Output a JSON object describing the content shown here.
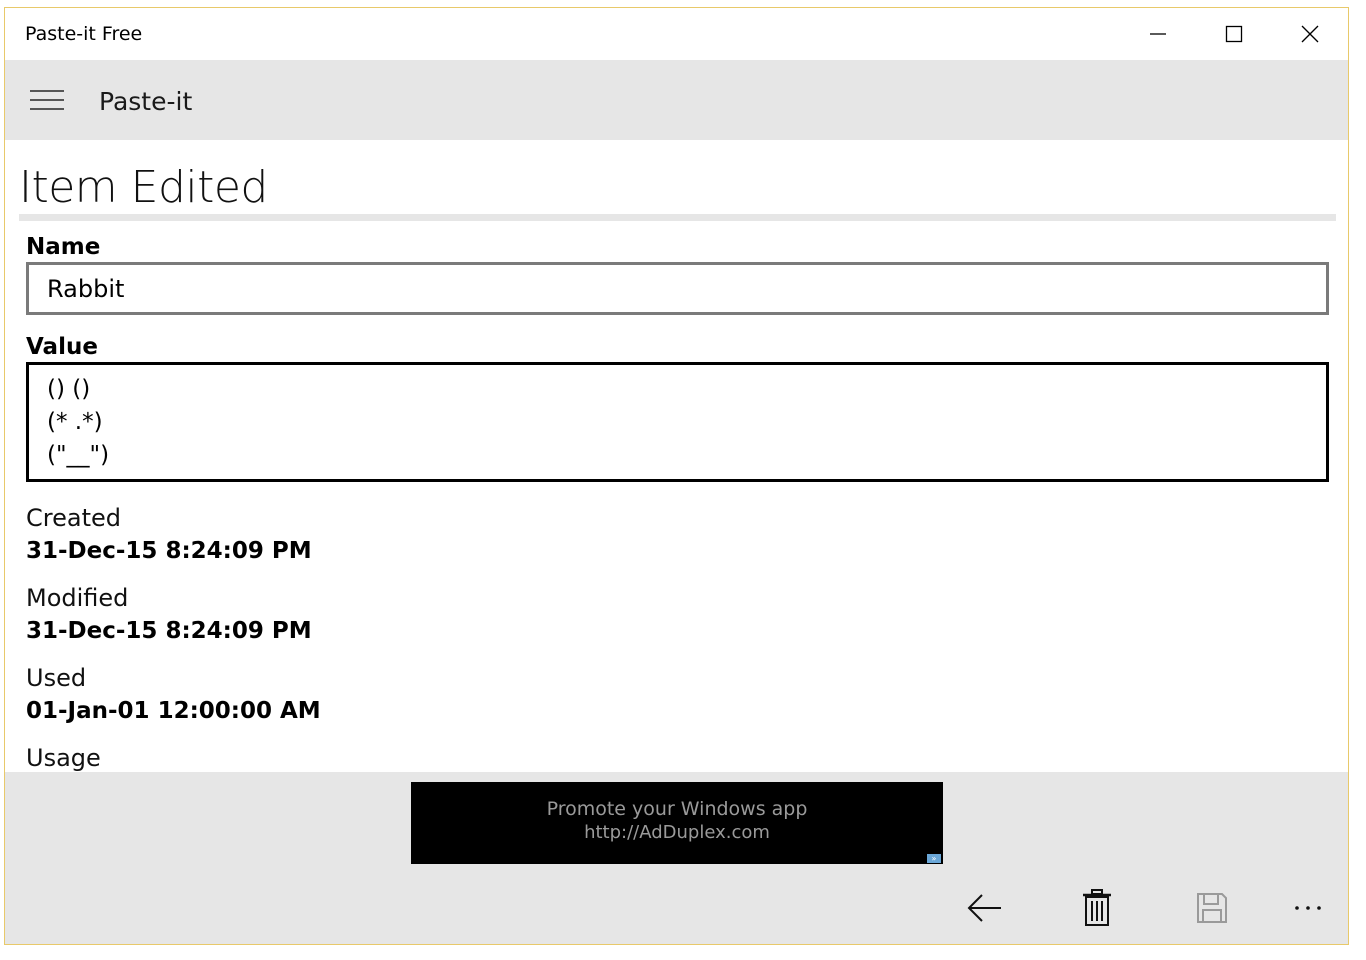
{
  "window": {
    "title": "Paste-it Free",
    "controls": {
      "minimize": "minimize",
      "maximize": "maximize",
      "close": "close"
    }
  },
  "header": {
    "menu_icon": "hamburger-icon",
    "title": "Paste-it"
  },
  "page": {
    "title": "Item Edited",
    "name_label": "Name",
    "name_value": "Rabbit",
    "value_label": "Value",
    "value_text": "() ()\n(* .*)\n(\"__\")",
    "created_label": "Created",
    "created_value": "31-Dec-15 8:24:09 PM",
    "modified_label": "Modified",
    "modified_value": "31-Dec-15 8:24:09 PM",
    "used_label": "Used",
    "used_value": "01-Jan-01 12:00:00 AM",
    "usage_label": "Usage"
  },
  "ad": {
    "line1": "Promote your Windows app",
    "line2": "http://AdDuplex.com",
    "overlay1": "AdDuplex",
    "overlay2": "FREE"
  },
  "appbar": {
    "back_icon": "back-arrow-icon",
    "delete_icon": "trash-icon",
    "save_icon": "save-icon",
    "more_icon": "more-icon",
    "more_glyph": "..."
  },
  "colors": {
    "chrome": "#e6e6e6",
    "window_border": "#e8c96a",
    "ad_background": "#000000"
  }
}
